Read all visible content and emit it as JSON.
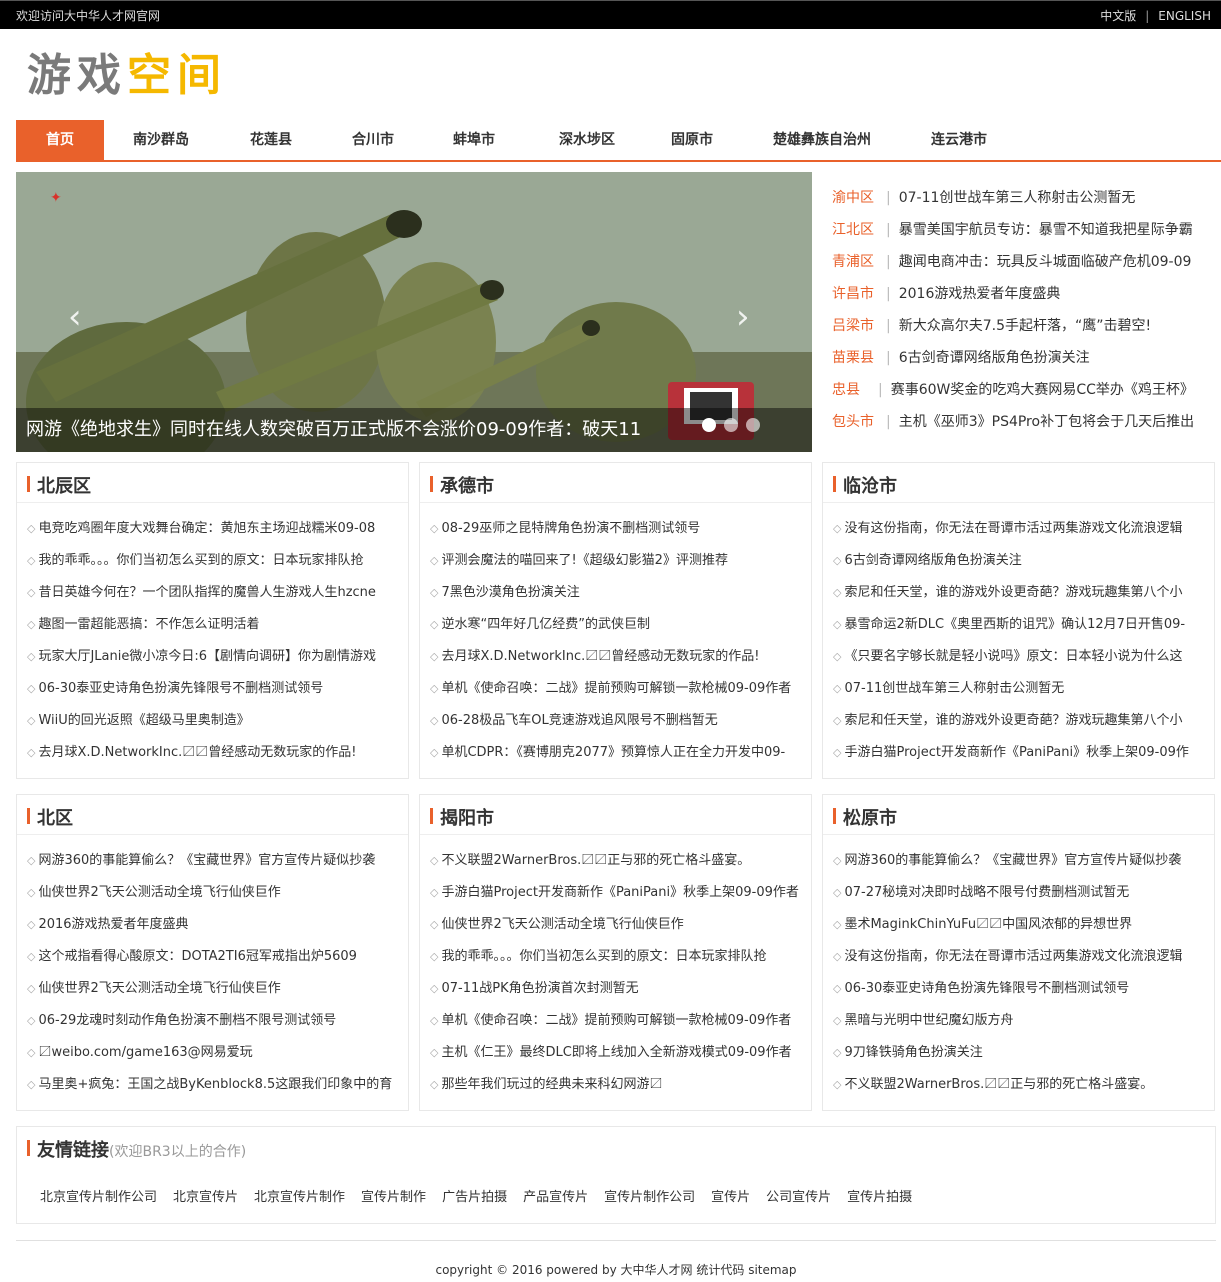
{
  "topbar": {
    "welcome": "欢迎访问大中华人才网官网",
    "lang_cn": "中文版",
    "lang_sep": "|",
    "lang_en": "ENGLISH"
  },
  "logo": {
    "part1": "游戏",
    "part2": "空间"
  },
  "nav": [
    "首页",
    "南沙群岛",
    "花莲县",
    "合川市",
    "蚌埠市",
    "深水埗区",
    "固原市",
    "楚雄彝族自治州",
    "连云港市"
  ],
  "slider": {
    "caption": "网游《绝地求生》同时在线人数突破百万正式版不会涨价09-09作者：破天11",
    "prev_icon": "chevron-left-icon",
    "next_icon": "chevron-right-icon",
    "active_dot": 0
  },
  "headlines": [
    {
      "area": "渝中区",
      "title": "07-11创世战车第三人称射击公测暂无"
    },
    {
      "area": "江北区",
      "title": "暴雪美国宇航员专访：暴雪不知道我把星际争霸"
    },
    {
      "area": "青浦区",
      "title": "趣闻电商冲击：玩具反斗城面临破产危机09-09"
    },
    {
      "area": "许昌市",
      "title": "2016游戏热爱者年度盛典"
    },
    {
      "area": "吕梁市",
      "title": "新大众高尔夫7.5手起杆落，“鹰”击碧空!"
    },
    {
      "area": "苗栗县",
      "title": "6古剑奇谭网络版角色扮演关注"
    },
    {
      "area": "忠县",
      "title": "赛事60W奖金的吃鸡大赛网易CC举办《鸡王杯》"
    },
    {
      "area": "包头市",
      "title": "主机《巫师3》PS4Pro补丁包将会于几天后推出"
    }
  ],
  "boxes": [
    {
      "name": "北辰区",
      "items": [
        "电竞吃鸡圈年度大戏舞台确定：黄旭东主场迎战糯米09-08",
        "我的乖乖。。。你们当初怎么买到的原文：日本玩家排队抢",
        "昔日英雄今何在？一个团队指挥的魔兽人生游戏人生hzcne",
        "趣图一雷超能恶搞：不作怎么证明活着",
        "玩家大厅JLanie微小凉今日:6【剧情向调研】你为剧情游戏",
        "06-30泰亚史诗角色扮演先锋限号不删档测试领号",
        "WiiU的回光返照《超级马里奥制造》",
        "去月球X.D.NetworkInc.〼〼曾经感动无数玩家的作品!"
      ]
    },
    {
      "name": "承德市",
      "items": [
        "08-29巫师之昆特牌角色扮演不删档测试领号",
        "评测会魔法的喵回来了!《超级幻影猫2》评测推荐",
        "7黑色沙漠角色扮演关注",
        "逆水寒“四年好几亿经费”的武侠巨制",
        "去月球X.D.NetworkInc.〼〼曾经感动无数玩家的作品!",
        "单机《使命召唤：二战》提前预购可解锁一款枪械09-09作者",
        "06-28极品飞车OL竞速游戏追风限号不删档暂无",
        "单机CDPR：《赛博朋克2077》预算惊人正在全力开发中09-"
      ]
    },
    {
      "name": "临沧市",
      "items": [
        "没有这份指南，你无法在哥谭市活过两集游戏文化流浪逻辑",
        "6古剑奇谭网络版角色扮演关注",
        "索尼和任天堂，谁的游戏外设更奇葩？游戏玩趣集第八个小",
        "暴雪命运2新DLC《奥里西斯的诅咒》确认12月7日开售09-",
        "《只要名字够长就是轻小说吗》原文：日本轻小说为什么这",
        "07-11创世战车第三人称射击公测暂无",
        "索尼和任天堂，谁的游戏外设更奇葩？游戏玩趣集第八个小",
        "手游白猫Project开发商新作《PaniPani》秋季上架09-09作"
      ]
    },
    {
      "name": "北区",
      "items": [
        "网游360的事能算偷么？《宝藏世界》官方宣传片疑似抄袭",
        "仙侠世界2飞天公测活动全境飞行仙侠巨作",
        "2016游戏热爱者年度盛典",
        "这个戒指看得心酸原文：DOTA2TI6冠军戒指出炉5609",
        "仙侠世界2飞天公测活动全境飞行仙侠巨作",
        "06-29龙魂时刻动作角色扮演不删档不限号测试领号",
        "〼weibo.com/game163@网易爱玩",
        "马里奥+疯兔：王国之战ByKenblock8.5这跟我们印象中的育"
      ]
    },
    {
      "name": "揭阳市",
      "items": [
        "不义联盟2WarnerBros.〼〼正与邪的死亡格斗盛宴。",
        "手游白猫Project开发商新作《PaniPani》秋季上架09-09作者",
        "仙侠世界2飞天公测活动全境飞行仙侠巨作",
        "我的乖乖。。。你们当初怎么买到的原文：日本玩家排队抢",
        "07-11战PK角色扮演首次封测暂无",
        "单机《使命召唤：二战》提前预购可解锁一款枪械09-09作者",
        "主机《仁王》最终DLC即将上线加入全新游戏模式09-09作者",
        "那些年我们玩过的经典未来科幻网游〼"
      ]
    },
    {
      "name": "松原市",
      "items": [
        "网游360的事能算偷么？《宝藏世界》官方宣传片疑似抄袭",
        "07-27秘境对决即时战略不限号付费删档测试暂无",
        "墨术MaginkChinYuFu〼〼中国风浓郁的异想世界",
        "没有这份指南，你无法在哥谭市活过两集游戏文化流浪逻辑",
        "06-30泰亚史诗角色扮演先锋限号不删档测试领号",
        "黑暗与光明中世纪魔幻版方舟",
        "9刀锋铁骑角色扮演关注",
        "不义联盟2WarnerBros.〼〼正与邪的死亡格斗盛宴。"
      ]
    }
  ],
  "links": {
    "title": "友情链接",
    "subtitle": "(欢迎BR3以上的合作)",
    "items": [
      "北京宣传片制作公司",
      "北京宣传片",
      "北京宣传片制作",
      "宣传片制作",
      "广告片拍摄",
      "产品宣传片",
      "宣传片制作公司",
      "宣传片",
      "公司宣传片",
      "宣传片拍摄"
    ]
  },
  "footer": {
    "copyright": "copyright © 2016 powered by",
    "site": "大中华人才网",
    "stats": "统计代码",
    "sitemap": "sitemap"
  },
  "colors": {
    "accent": "#e9612b",
    "logo_gray": "#7a7a7a",
    "logo_yellow": "#f5b800"
  }
}
